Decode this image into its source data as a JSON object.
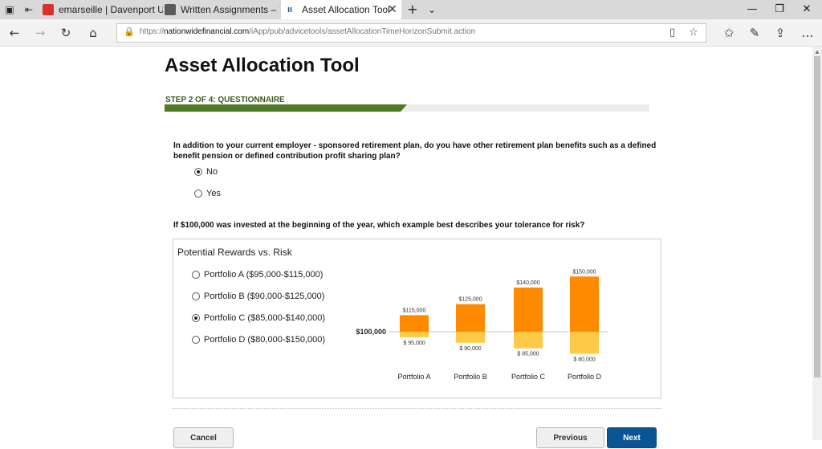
{
  "browser": {
    "tabs": [
      {
        "label": "emarseille | Davenport Univ",
        "fav_color": "#d9312b"
      },
      {
        "label": "Written Assignments – Win",
        "fav_color": "#5b5b5b"
      },
      {
        "label": "Asset Allocation Tool",
        "fav_color": "#ffffff"
      }
    ],
    "url_prefix": "https://",
    "url_host": "nationwidefinancial.com",
    "url_path": "/iApp/pub/advicetools/assetAllocationTimeHorizonSubmit.action"
  },
  "page": {
    "title": "Asset Allocation Tool",
    "step_label": "STEP 2 OF 4: QUESTIONNAIRE",
    "progress_fraction": 0.5
  },
  "q1": {
    "text": "In addition to your current employer - sponsored retirement plan, do you have other retirement plan benefits such as a defined benefit pension or defined contribution profit sharing plan?",
    "options": [
      {
        "label": "No",
        "selected": true
      },
      {
        "label": "Yes",
        "selected": false
      }
    ]
  },
  "q2": {
    "text": "If $100,000 was invested at the beginning of the year, which example best describes your tolerance for risk?",
    "box_title": "Potential Rewards vs. Risk",
    "options": [
      {
        "label": "Portfolio A ($95,000-$115,000)",
        "selected": false
      },
      {
        "label": "Portfolio B ($90,000-$125,000)",
        "selected": false
      },
      {
        "label": "Portfolio C ($85,000-$140,000)",
        "selected": true
      },
      {
        "label": "Portfolio D ($80,000-$150,000)",
        "selected": false
      }
    ]
  },
  "chart_data": {
    "type": "bar",
    "baseline_label": "$100,000",
    "baseline": 100000,
    "categories": [
      "Portfolio A",
      "Portfolio B",
      "Portfolio C",
      "Portfolio D"
    ],
    "high": [
      115000,
      125000,
      140000,
      150000
    ],
    "low": [
      95000,
      90000,
      85000,
      80000
    ],
    "high_labels": [
      "$115,000",
      "$125,000",
      "$140,000",
      "$150,000"
    ],
    "low_labels": [
      "$ 95,000",
      "$ 90,000",
      "$ 85,000",
      "$ 80,000"
    ],
    "colors": {
      "gain": "#ff8a00",
      "loss": "#ffc94a",
      "baseline": "#cccccc"
    }
  },
  "buttons": {
    "cancel": "Cancel",
    "previous": "Previous",
    "next": "Next"
  }
}
